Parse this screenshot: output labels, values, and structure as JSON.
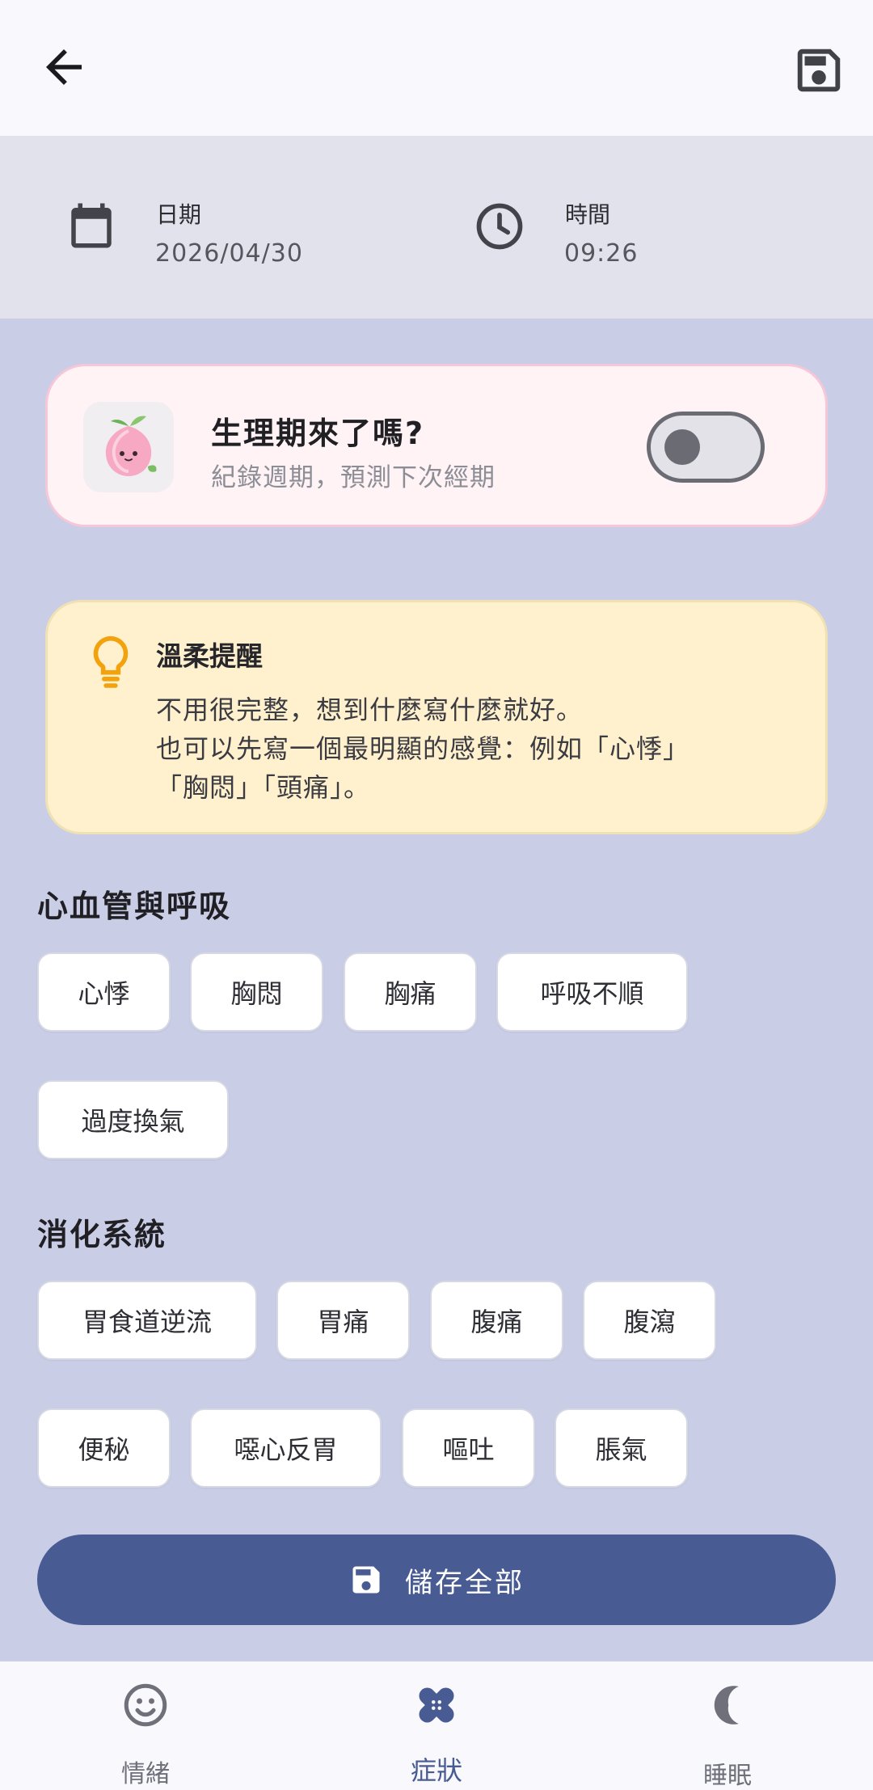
{
  "appbar": {
    "back_icon": "arrow-left-icon",
    "save_icon": "floppy-disk-icon"
  },
  "datetime": {
    "date_label": "日期",
    "date_value": "2026/04/30",
    "time_label": "時間",
    "time_value": "09:26"
  },
  "period": {
    "title": "生理期來了嗎?",
    "subtitle": "紀錄週期，預測下次經期",
    "toggle_on": false
  },
  "tip": {
    "title": "溫柔提醒",
    "lines": [
      "不用很完整，想到什麼寫什麼就好。",
      "也可以先寫一個最明顯的感覺：例如「心悸」",
      "「胸悶」「頭痛」。"
    ]
  },
  "sections": [
    {
      "title": "心血管與呼吸",
      "chips": [
        "心悸",
        "胸悶",
        "胸痛",
        "呼吸不順",
        "過度換氣"
      ]
    },
    {
      "title": "消化系統",
      "chips": [
        "胃食道逆流",
        "胃痛",
        "腹痛",
        "腹瀉",
        "便秘",
        "噁心反胃",
        "嘔吐",
        "脹氣"
      ]
    }
  ],
  "save_all": {
    "label": "儲存全部"
  },
  "nav": [
    {
      "label": "情緒",
      "icon": "smiley-face-icon",
      "active": false
    },
    {
      "label": "症狀",
      "icon": "bandage-icon",
      "active": true
    },
    {
      "label": "睡眠",
      "icon": "moon-icon",
      "active": false
    }
  ],
  "colors": {
    "primary": "#485b93",
    "background": "#c9cde6",
    "period_card": "#fff3f5",
    "tip_card": "#fff1cd",
    "tip_icon": "#f2a20c"
  }
}
